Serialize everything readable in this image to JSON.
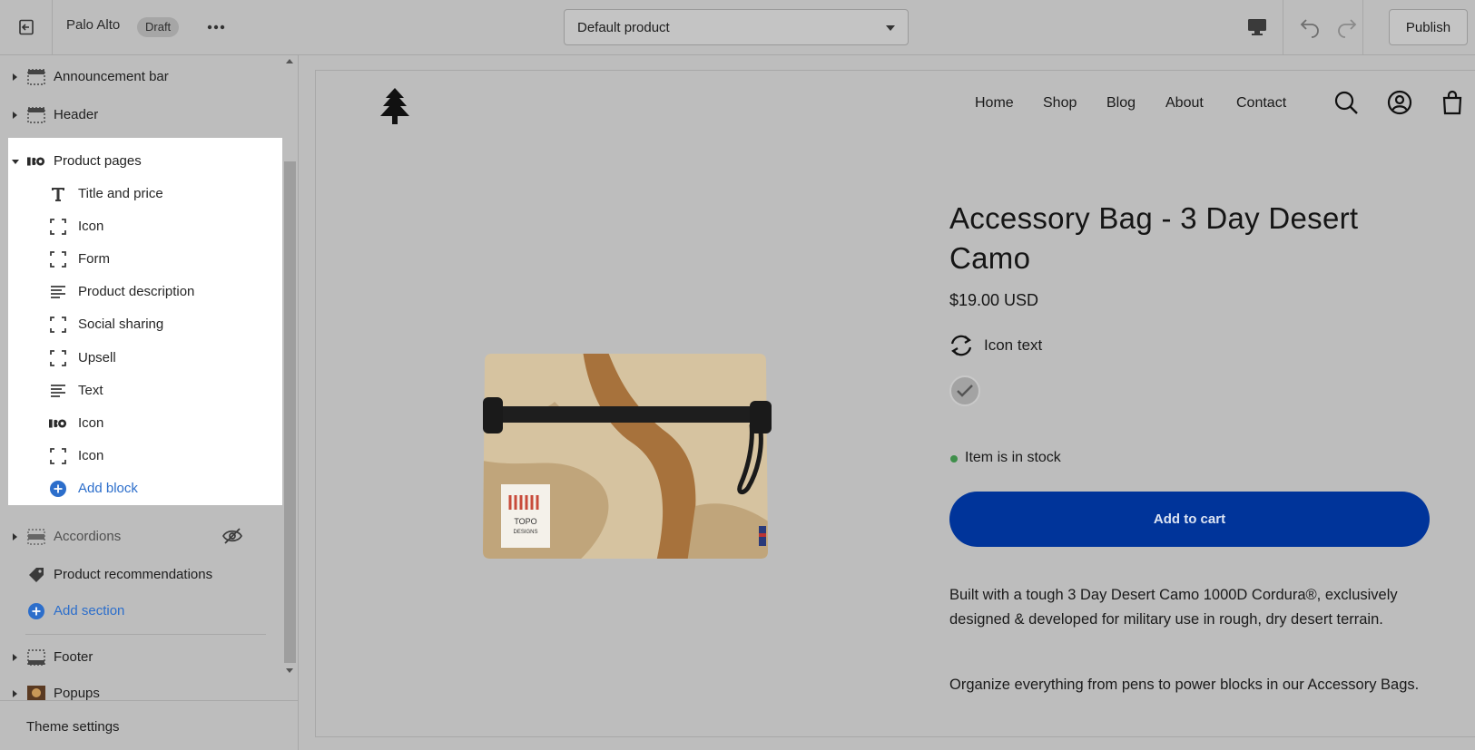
{
  "topbar": {
    "store_name": "Palo Alto",
    "status_badge": "Draft",
    "template_select": "Default product",
    "publish_label": "Publish"
  },
  "sidebar": {
    "sections_top": [
      {
        "label": "Announcement bar",
        "icon": "section-icon"
      },
      {
        "label": "Header",
        "icon": "section-icon"
      }
    ],
    "product_pages": {
      "label": "Product pages",
      "blocks": [
        {
          "label": "Title and price",
          "icon": "text-icon"
        },
        {
          "label": "Icon",
          "icon": "block-frame-icon"
        },
        {
          "label": "Form",
          "icon": "block-frame-icon"
        },
        {
          "label": "Product description",
          "icon": "paragraph-icon"
        },
        {
          "label": "Social sharing",
          "icon": "block-frame-icon"
        },
        {
          "label": "Upsell",
          "icon": "block-frame-icon"
        },
        {
          "label": "Text",
          "icon": "paragraph-icon"
        },
        {
          "label": "Icon",
          "icon": "image-thumbnail-icon"
        },
        {
          "label": "Icon",
          "icon": "block-frame-icon"
        }
      ],
      "add_block": "Add block"
    },
    "sections_bottom": [
      {
        "label": "Accordions",
        "icon": "section-icon",
        "hidden": true
      },
      {
        "label": "Product recommendations",
        "icon": "tag-icon"
      }
    ],
    "add_section": "Add section",
    "footer_sections": [
      {
        "label": "Footer",
        "icon": "section-icon"
      },
      {
        "label": "Popups",
        "icon": "image-thumbnail-icon"
      }
    ],
    "theme_settings": "Theme settings"
  },
  "preview": {
    "nav": [
      "Home",
      "Shop",
      "Blog",
      "About",
      "Contact"
    ],
    "product_title": "Accessory Bag - 3 Day Desert Camo",
    "price": "$19.00 USD",
    "icon_text": "Icon text",
    "stock": "Item is in stock",
    "add_to_cart": "Add to cart",
    "description_1": "Built with a tough 3 Day Desert Camo 1000D Cordura®, exclusively designed & developed for military use in rough, dry desert terrain.",
    "description_2": "Organize everything from pens to power blocks in our Accessory Bags.",
    "image_label": "TOPO DESIGNS"
  },
  "colors": {
    "highlight_bg": "#ffffff",
    "link_blue": "#2c6ecb",
    "cart_button": "#00349a",
    "stock_green": "#3f8f4b"
  }
}
